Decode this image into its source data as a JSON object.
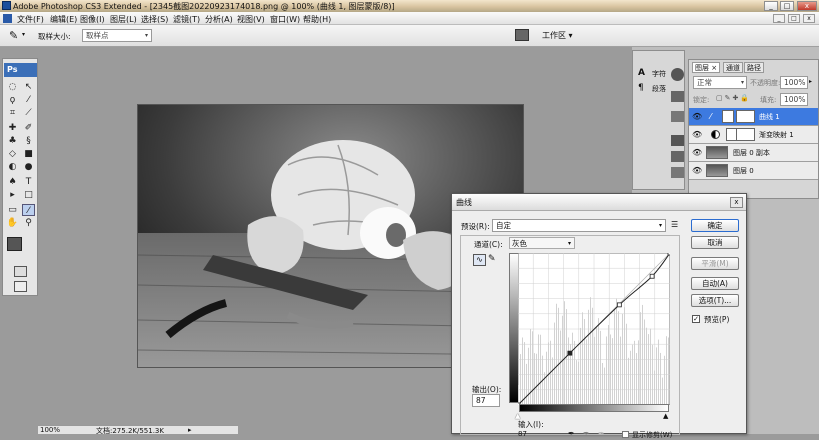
{
  "window": {
    "title": "Adobe Photoshop CS3 Extended - [2345截图20220923174018.png @ 100% (曲线 1, 图层蒙版/8)]",
    "minimize": "_",
    "maximize": "□",
    "close": "x"
  },
  "menu": {
    "items": [
      "文件(F)",
      "编辑(E)",
      "图像(I)",
      "图层(L)",
      "选择(S)",
      "滤镜(T)",
      "分析(A)",
      "视图(V)",
      "窗口(W)",
      "帮助(H)"
    ],
    "mdi": [
      "_",
      "□",
      "x"
    ]
  },
  "options": {
    "sample_size_label": "取样大小:",
    "sample_size_value": "取样点",
    "workspace": "工作区 ▾"
  },
  "toolbox": {
    "logo": "Ps"
  },
  "status": {
    "zoom": "100%",
    "doc": "文档:275.2K/551.3K"
  },
  "dock": {
    "char_label": "字符",
    "para_label": "段落"
  },
  "layers": {
    "tabs": [
      "图层 ×",
      "通道",
      "路径"
    ],
    "blend": "正常",
    "opacity_label": "不透明度:",
    "opacity": "100%",
    "lock_label": "锁定:",
    "fill_label": "填充:",
    "fill": "100%",
    "items": [
      {
        "name": "曲线 1",
        "selected": true
      },
      {
        "name": "渐变映射 1",
        "selected": false
      },
      {
        "name": "图层 0 副本",
        "selected": false
      },
      {
        "name": "图层 0",
        "selected": false
      }
    ]
  },
  "curves": {
    "title": "曲线",
    "preset_label": "预设(R):",
    "preset_value": "自定",
    "channel_label": "通道(C):",
    "channel_value": "灰色",
    "ok": "确定",
    "cancel": "取消",
    "smooth": "平滑(M)",
    "auto": "自动(A)",
    "options": "选项(T)...",
    "preview": "预览(P)",
    "output_label": "输出(O):",
    "output_value": "87",
    "input_label": "输入(I):",
    "input_value": "87",
    "show_clip": "显示修剪(W)",
    "points": [
      [
        0,
        0
      ],
      [
        87,
        87
      ],
      [
        170,
        168
      ],
      [
        225,
        216
      ],
      [
        255,
        255
      ]
    ]
  }
}
